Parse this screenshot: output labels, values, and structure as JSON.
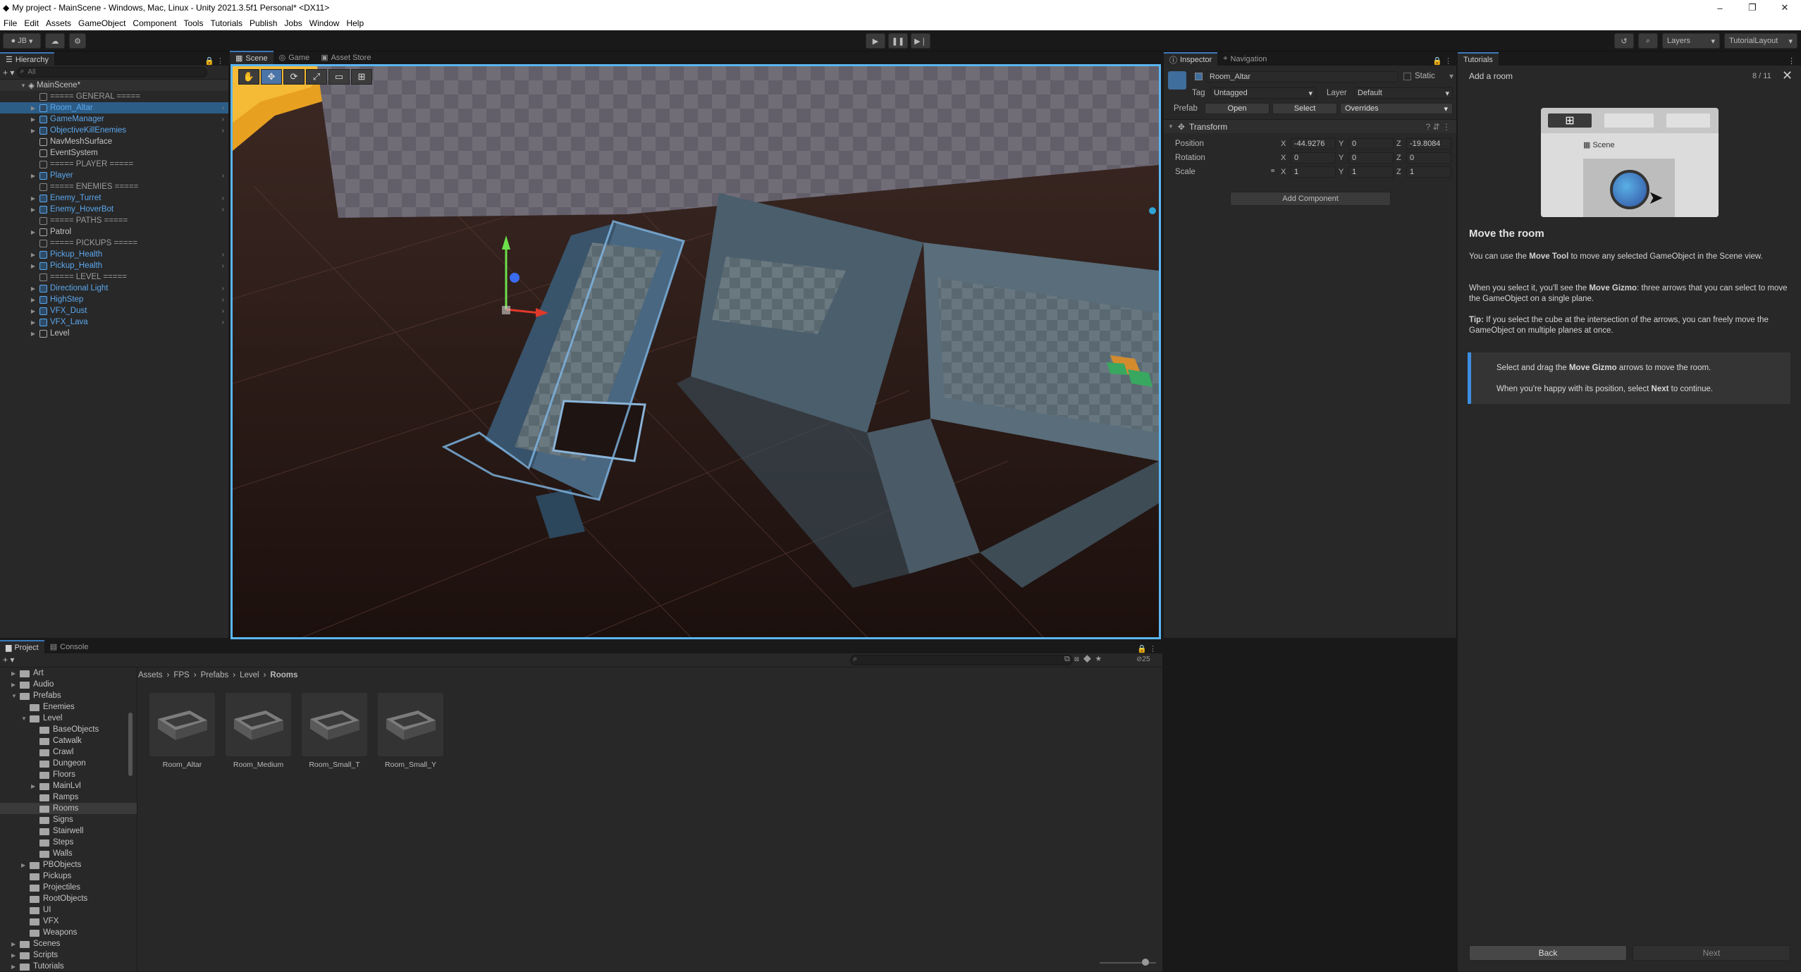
{
  "window": {
    "title": "My project - MainScene - Windows, Mac, Linux - Unity 2021.3.5f1 Personal* <DX11>",
    "controls": [
      "–",
      "❐",
      "✕"
    ]
  },
  "menu": [
    "File",
    "Edit",
    "Assets",
    "GameObject",
    "Component",
    "Tools",
    "Tutorials",
    "Publish",
    "Jobs",
    "Window",
    "Help"
  ],
  "toolbar": {
    "account": "JB",
    "layers": "Layers",
    "layout": "TutorialLayout"
  },
  "hierarchy": {
    "tab": "Hierarchy",
    "search_placeholder": "All",
    "scene": "MainScene*",
    "items": [
      {
        "label": "===== GENERAL =====",
        "kind": "sep"
      },
      {
        "label": "Room_Altar",
        "kind": "prefab",
        "selected": true
      },
      {
        "label": "GameManager",
        "kind": "prefab"
      },
      {
        "label": "ObjectiveKillEnemies",
        "kind": "prefab"
      },
      {
        "label": "NavMeshSurface",
        "kind": "plain"
      },
      {
        "label": "EventSystem",
        "kind": "plain"
      },
      {
        "label": "===== PLAYER =====",
        "kind": "sep"
      },
      {
        "label": "Player",
        "kind": "prefab"
      },
      {
        "label": "===== ENEMIES =====",
        "kind": "sep"
      },
      {
        "label": "Enemy_Turret",
        "kind": "prefab"
      },
      {
        "label": "Enemy_HoverBot",
        "kind": "prefab"
      },
      {
        "label": "===== PATHS =====",
        "kind": "sep"
      },
      {
        "label": "Patrol",
        "kind": "plain"
      },
      {
        "label": "===== PICKUPS =====",
        "kind": "sep"
      },
      {
        "label": "Pickup_Health",
        "kind": "prefab"
      },
      {
        "label": "Pickup_Health",
        "kind": "prefab"
      },
      {
        "label": "===== LEVEL =====",
        "kind": "sep"
      },
      {
        "label": "Directional Light",
        "kind": "prefab"
      },
      {
        "label": "HighStep",
        "kind": "prefab"
      },
      {
        "label": "VFX_Dust",
        "kind": "prefab"
      },
      {
        "label": "VFX_Lava",
        "kind": "prefab"
      },
      {
        "label": "Level",
        "kind": "plain"
      }
    ]
  },
  "center_tabs": [
    "Scene",
    "Game",
    "Asset Store"
  ],
  "inspector": {
    "tabs": [
      "Inspector",
      "Navigation"
    ],
    "object_name": "Room_Altar",
    "static_label": "Static",
    "tag_label": "Tag",
    "tag_value": "Untagged",
    "layer_label": "Layer",
    "layer_value": "Default",
    "prefab_label": "Prefab",
    "prefab_open": "Open",
    "prefab_select": "Select",
    "prefab_overrides": "Overrides",
    "component": "Transform",
    "position_label": "Position",
    "rotation_label": "Rotation",
    "scale_label": "Scale",
    "position": {
      "x": "-44.9276",
      "y": "0",
      "z": "-19.8084"
    },
    "rotation": {
      "x": "0",
      "y": "0",
      "z": "0"
    },
    "scale": {
      "x": "1",
      "y": "1",
      "z": "1"
    },
    "axis_x": "X",
    "axis_y": "Y",
    "axis_z": "Z",
    "add_component": "Add Component"
  },
  "tutorial": {
    "tab": "Tutorials",
    "header": "Add a room",
    "progress": "8 / 11",
    "preview_scene": "Scene",
    "title": "Move the room",
    "p1_pre": "You can use the ",
    "p1_bold": "Move Tool",
    "p1_post": " to move any selected GameObject in the Scene view.",
    "p2_pre": "When you select it, you'll see the ",
    "p2_bold": "Move Gizmo",
    "p2_post": ": three arrows that you can select to move the GameObject on a single plane.",
    "p3_bold": "Tip:",
    "p3_post": " If you select the cube at the intersection of the arrows, you can freely move the GameObject on multiple planes at once.",
    "instr1_pre": "Select and drag the ",
    "instr1_bold": "Move Gizmo",
    "instr1_post": " arrows to move the room.",
    "instr2_pre": "When you're happy with its position, select ",
    "instr2_bold": "Next",
    "instr2_post": " to continue.",
    "back": "Back",
    "next": "Next"
  },
  "project": {
    "tabs": [
      "Project",
      "Console"
    ],
    "tree": [
      {
        "label": "Art",
        "depth": 1,
        "arrow": "right"
      },
      {
        "label": "Audio",
        "depth": 1,
        "arrow": "right"
      },
      {
        "label": "Prefabs",
        "depth": 1,
        "arrow": "down"
      },
      {
        "label": "Enemies",
        "depth": 2,
        "arrow": ""
      },
      {
        "label": "Level",
        "depth": 2,
        "arrow": "down"
      },
      {
        "label": "BaseObjects",
        "depth": 3,
        "arrow": ""
      },
      {
        "label": "Catwalk",
        "depth": 3,
        "arrow": ""
      },
      {
        "label": "Crawl",
        "depth": 3,
        "arrow": ""
      },
      {
        "label": "Dungeon",
        "depth": 3,
        "arrow": ""
      },
      {
        "label": "Floors",
        "depth": 3,
        "arrow": ""
      },
      {
        "label": "MainLvl",
        "depth": 3,
        "arrow": "right"
      },
      {
        "label": "Ramps",
        "depth": 3,
        "arrow": ""
      },
      {
        "label": "Rooms",
        "depth": 3,
        "arrow": "",
        "selected": true
      },
      {
        "label": "Signs",
        "depth": 3,
        "arrow": ""
      },
      {
        "label": "Stairwell",
        "depth": 3,
        "arrow": ""
      },
      {
        "label": "Steps",
        "depth": 3,
        "arrow": ""
      },
      {
        "label": "Walls",
        "depth": 3,
        "arrow": ""
      },
      {
        "label": "PBObjects",
        "depth": 2,
        "arrow": "right"
      },
      {
        "label": "Pickups",
        "depth": 2,
        "arrow": ""
      },
      {
        "label": "Projectiles",
        "depth": 2,
        "arrow": ""
      },
      {
        "label": "RootObjects",
        "depth": 2,
        "arrow": ""
      },
      {
        "label": "UI",
        "depth": 2,
        "arrow": ""
      },
      {
        "label": "VFX",
        "depth": 2,
        "arrow": ""
      },
      {
        "label": "Weapons",
        "depth": 2,
        "arrow": ""
      },
      {
        "label": "Scenes",
        "depth": 1,
        "arrow": "right"
      },
      {
        "label": "Scripts",
        "depth": 1,
        "arrow": "right"
      },
      {
        "label": "Tutorials",
        "depth": 1,
        "arrow": "right"
      }
    ],
    "breadcrumb": [
      "Assets",
      "FPS",
      "Prefabs",
      "Level",
      "Rooms"
    ],
    "assets": [
      "Room_Altar",
      "Room_Medium",
      "Room_Small_T",
      "Room_Small_Y"
    ],
    "count": "25"
  }
}
